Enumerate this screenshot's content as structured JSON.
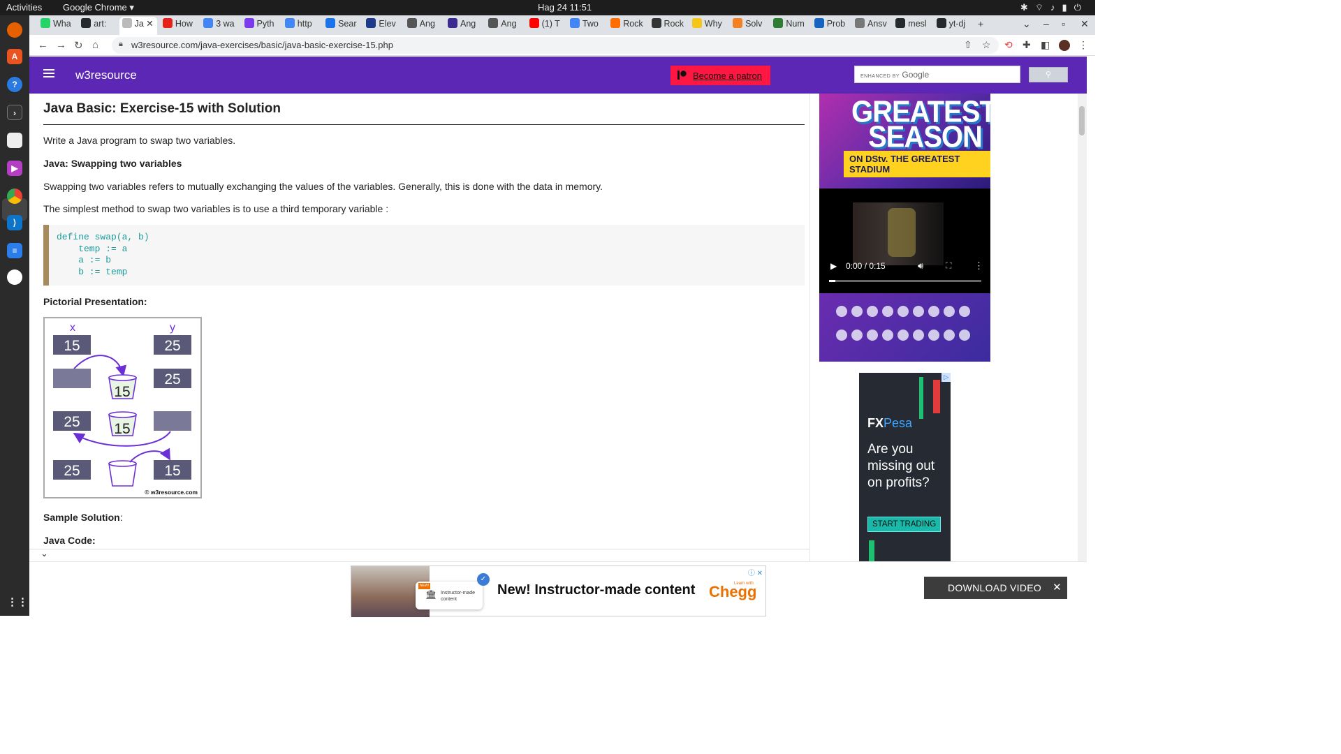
{
  "os": {
    "activities": "Activities",
    "app_menu": "Google Chrome ▾",
    "clock": "Hag 24  11:51"
  },
  "tabs": [
    {
      "label": "Wha",
      "color": "#25d366"
    },
    {
      "label": "art:",
      "color": "#24292e"
    },
    {
      "label": "Ja",
      "color": "#bbbbbb",
      "active": true
    },
    {
      "label": "How",
      "color": "#e62117"
    },
    {
      "label": "3 wa",
      "color": "#4285f4"
    },
    {
      "label": "Pyth",
      "color": "#7c3aed"
    },
    {
      "label": "http",
      "color": "#4285f4"
    },
    {
      "label": "Sear",
      "color": "#1a73e8"
    },
    {
      "label": "Elev",
      "color": "#1e3a8a"
    },
    {
      "label": "Ang",
      "color": "#555555"
    },
    {
      "label": "Ang",
      "color": "#3b2a8f"
    },
    {
      "label": "Ang",
      "color": "#555555"
    },
    {
      "label": "(1) T",
      "color": "#ff0000"
    },
    {
      "label": "Two",
      "color": "#4285f4"
    },
    {
      "label": "Rock",
      "color": "#ff6d00"
    },
    {
      "label": "Rock",
      "color": "#333333"
    },
    {
      "label": "Why",
      "color": "#f5c518"
    },
    {
      "label": "Solv",
      "color": "#f48024"
    },
    {
      "label": "Num",
      "color": "#2e7d32"
    },
    {
      "label": "Prob",
      "color": "#1565c0"
    },
    {
      "label": "Ansv",
      "color": "#777777"
    },
    {
      "label": "mesl",
      "color": "#24292e"
    },
    {
      "label": "yt-dj",
      "color": "#24292e"
    }
  ],
  "browser": {
    "url": "w3resource.com/java-exercises/basic/java-basic-exercise-15.php"
  },
  "site": {
    "name": "w3resource",
    "patron_label": "Become a patron",
    "search_hint_small": "ENHANCED BY",
    "search_hint_brand": "Google",
    "search_button_icon": "search-icon"
  },
  "article": {
    "title": "Java Basic: Exercise-15 with Solution",
    "intro": "Write a Java program to swap two variables.",
    "subheading": "Java: Swapping two variables",
    "para1": "Swapping two variables refers to mutually exchanging the values of the variables. Generally, this is done with the data in memory.",
    "para2": "The simplest method to swap two variables is to use a third temporary variable :",
    "code": "define swap(a, b)\n    temp := a\n    a := b\n    b := temp",
    "pictorial_heading": "Pictorial Presentation:",
    "sample_solution_bold": "Sample Solution",
    "sample_solution_colon": ":",
    "java_code_heading": "Java Code:"
  },
  "diagram": {
    "var_x": "x",
    "var_y": "y",
    "row1_x": "15",
    "row1_y": "25",
    "row2_temp": "15",
    "row2_y": "25",
    "row3_x": "25",
    "row3_temp": "15",
    "row4_x": "25",
    "row4_y": "15",
    "credit": "© w3resource.com"
  },
  "ads": {
    "greatest_line1": "GREATEST",
    "greatest_line2": "SEASON",
    "greatest_tagline": "ON DStv. THE GREATEST STADIUM",
    "video_time": "0:00 / 0:15",
    "video_progress": 0,
    "fx_brand_a": "FX",
    "fx_brand_b": "Pesa",
    "fx_headline": "Are you missing out on profits?",
    "fx_cta": "START TRADING",
    "chegg_card_new": "NEW!",
    "chegg_card_text": "Instructor-made content",
    "chegg_message": "New! Instructor-made content",
    "chegg_logo": "Chegg",
    "chegg_learn": "Learn with",
    "download_video": "DOWNLOAD VIDEO"
  },
  "colors": {
    "site_purple": "#5d27b5",
    "patron_red": "#ff1744",
    "code_teal": "#1d9a9a",
    "diagram_purple": "#6b2fd6",
    "diagram_box": "#5a5a78"
  }
}
